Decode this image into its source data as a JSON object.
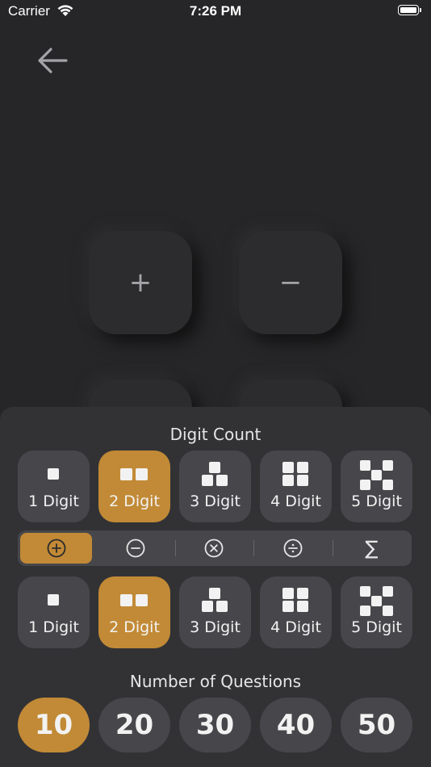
{
  "status": {
    "carrier": "Carrier",
    "time": "7:26 PM"
  },
  "operations": {
    "add": "+",
    "subtract": "−"
  },
  "sheet": {
    "digit_count_title": "Digit Count",
    "digits_top": [
      {
        "label": "1 Digit",
        "active": false
      },
      {
        "label": "2 Digit",
        "active": true
      },
      {
        "label": "3 Digit",
        "active": false
      },
      {
        "label": "4 Digit",
        "active": false
      },
      {
        "label": "5 Digit",
        "active": false
      }
    ],
    "operation_segments": [
      "add",
      "subtract",
      "multiply",
      "divide",
      "sum"
    ],
    "operation_active": "add",
    "sum_symbol": "∑",
    "digits_bottom": [
      {
        "label": "1 Digit",
        "active": false
      },
      {
        "label": "2 Digit",
        "active": true
      },
      {
        "label": "3 Digit",
        "active": false
      },
      {
        "label": "4 Digit",
        "active": false
      },
      {
        "label": "5 Digit",
        "active": false
      }
    ],
    "questions_title": "Number of Questions",
    "questions": [
      {
        "label": "10",
        "active": true
      },
      {
        "label": "20",
        "active": false
      },
      {
        "label": "30",
        "active": false
      },
      {
        "label": "40",
        "active": false
      },
      {
        "label": "50",
        "active": false
      }
    ]
  },
  "colors": {
    "accent": "#c28a36",
    "chip": "#47474b",
    "sheet": "#323235",
    "background": "#262628"
  }
}
